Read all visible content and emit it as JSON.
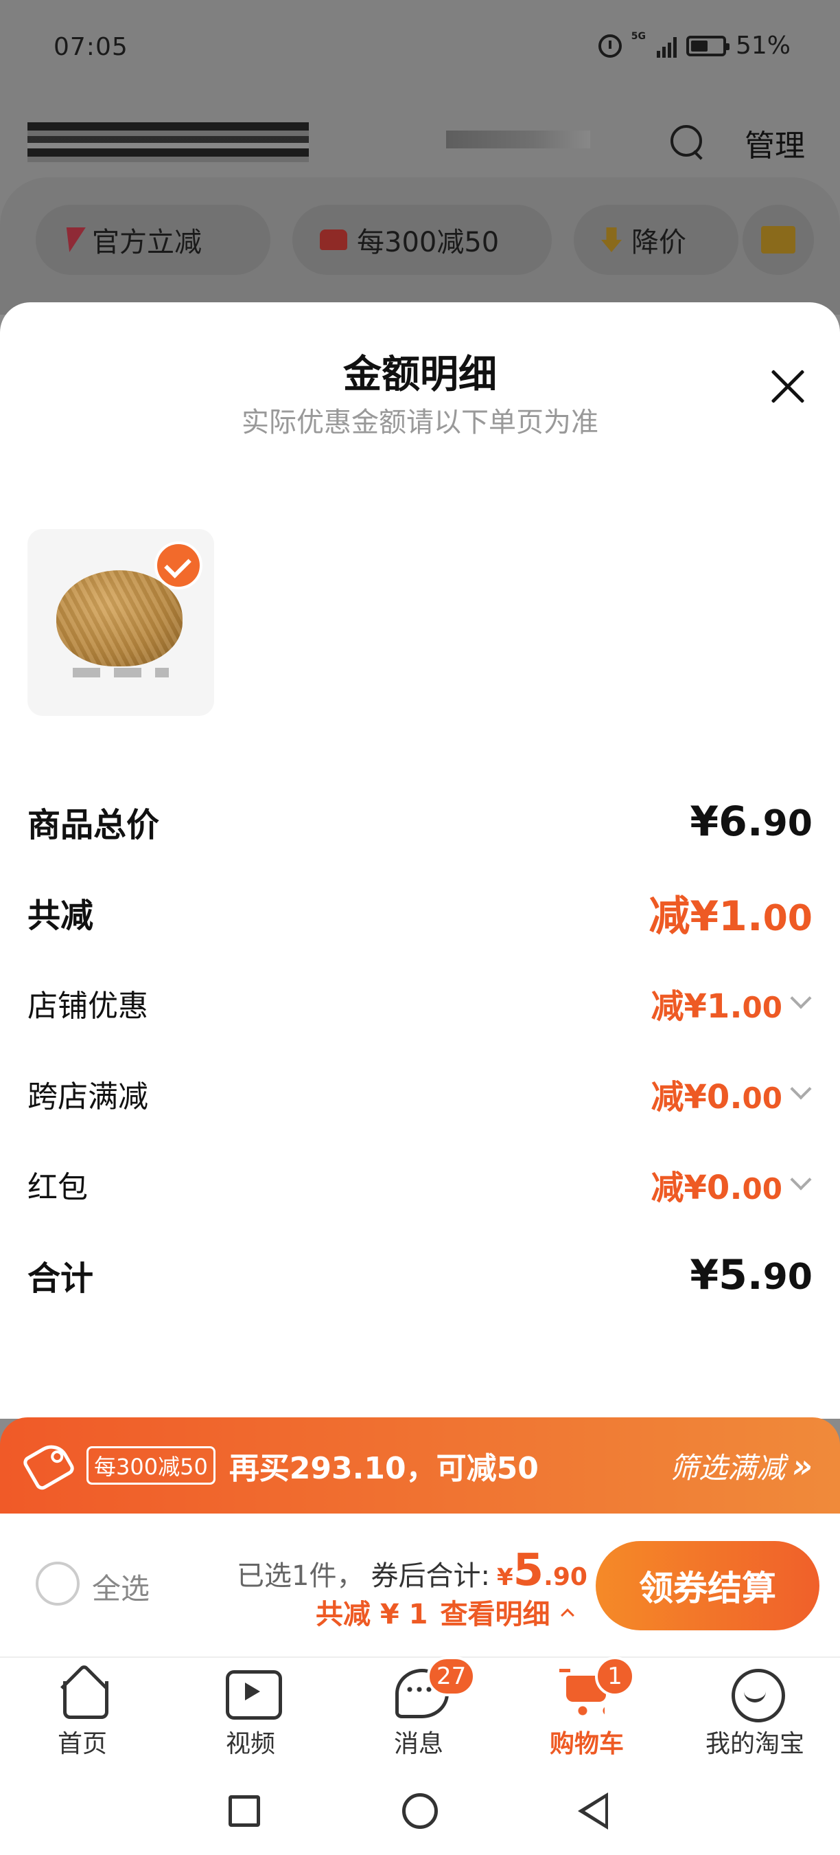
{
  "status_bar": {
    "time": "07:05",
    "network": "5G",
    "battery": "51%"
  },
  "top_nav": {
    "manage_label": "管理"
  },
  "chips": [
    {
      "label": "官方立减",
      "icon": "lightning-icon"
    },
    {
      "label": "每300减50",
      "icon": "store-icon"
    },
    {
      "label": "降价",
      "icon": "price-down-icon"
    },
    {
      "label": "",
      "icon": "folder-icon"
    }
  ],
  "sheet": {
    "title": "金额明细",
    "subtitle": "实际优惠金额请以下单页为准",
    "rows": {
      "total": {
        "label": "商品总价",
        "prefix": "",
        "int": "¥6.",
        "dec": "90"
      },
      "discount": {
        "label": "共减",
        "prefix": "减",
        "int": "¥1.",
        "dec": "00"
      },
      "shop": {
        "label": "店铺优惠",
        "prefix": "减",
        "int": "¥1.",
        "dec": "00"
      },
      "cross": {
        "label": "跨店满减",
        "prefix": "减",
        "int": "¥0.",
        "dec": "00"
      },
      "redpack": {
        "label": "红包",
        "prefix": "减",
        "int": "¥0.",
        "dec": "00"
      },
      "sum": {
        "label": "合计",
        "prefix": "",
        "int": "¥5.",
        "dec": "90"
      }
    }
  },
  "promo": {
    "badge": "每300减50",
    "text": "再买293.10，可减50",
    "filter": "筛选满减",
    "filter_arrow": "»"
  },
  "checkout": {
    "select_all": "全选",
    "selected_count": "已选1件，",
    "after_coupon_label": "券后合计:",
    "price_currency": "¥",
    "price_int": "5",
    "price_dec": ".90",
    "saved_text": "共减 ¥ 1",
    "detail_link": "查看明细",
    "pay_button": "领券结算"
  },
  "tabbar": [
    {
      "label": "首页",
      "icon": "home-icon"
    },
    {
      "label": "视频",
      "icon": "video-icon"
    },
    {
      "label": "消息",
      "icon": "message-icon",
      "badge": "27"
    },
    {
      "label": "购物车",
      "icon": "cart-icon",
      "badge": "1",
      "active": true
    },
    {
      "label": "我的淘宝",
      "icon": "smile-icon"
    }
  ],
  "colors": {
    "accent": "#ee5a24",
    "button_start": "#f58a28",
    "button_end": "#f0602a"
  }
}
